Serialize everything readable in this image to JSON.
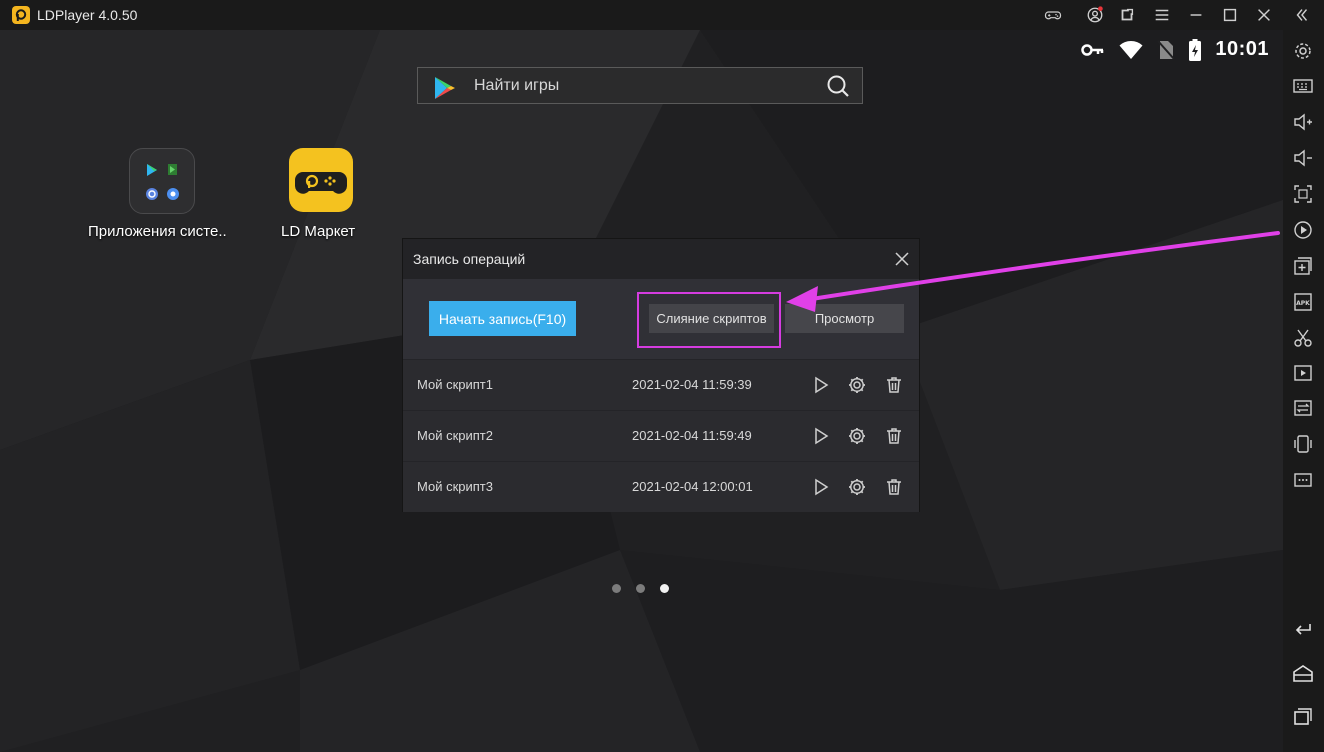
{
  "window": {
    "title": "LDPlayer 4.0.50"
  },
  "statusbar": {
    "time": "10:01"
  },
  "search": {
    "placeholder": "Найти игры"
  },
  "desktop": {
    "apps": [
      {
        "label": "Приложения систе.."
      },
      {
        "label": "LD Маркет"
      }
    ],
    "page_dots": {
      "count": 3,
      "active_index": 2
    }
  },
  "dialog": {
    "title": "Запись операций",
    "record_button": "Начать запись(F10)",
    "merge_button": "Слияние скриптов",
    "preview_button": "Просмотр",
    "scripts": [
      {
        "name": "Мой скрипт1",
        "date": "2021-02-04 11:59:39"
      },
      {
        "name": "Мой скрипт2",
        "date": "2021-02-04 11:59:49"
      },
      {
        "name": "Мой скрипт3",
        "date": "2021-02-04 12:00:01"
      }
    ]
  },
  "annotation": {
    "color": "#e040e8"
  },
  "colors": {
    "accent": "#3aaeec",
    "logo": "#f4b51f"
  }
}
